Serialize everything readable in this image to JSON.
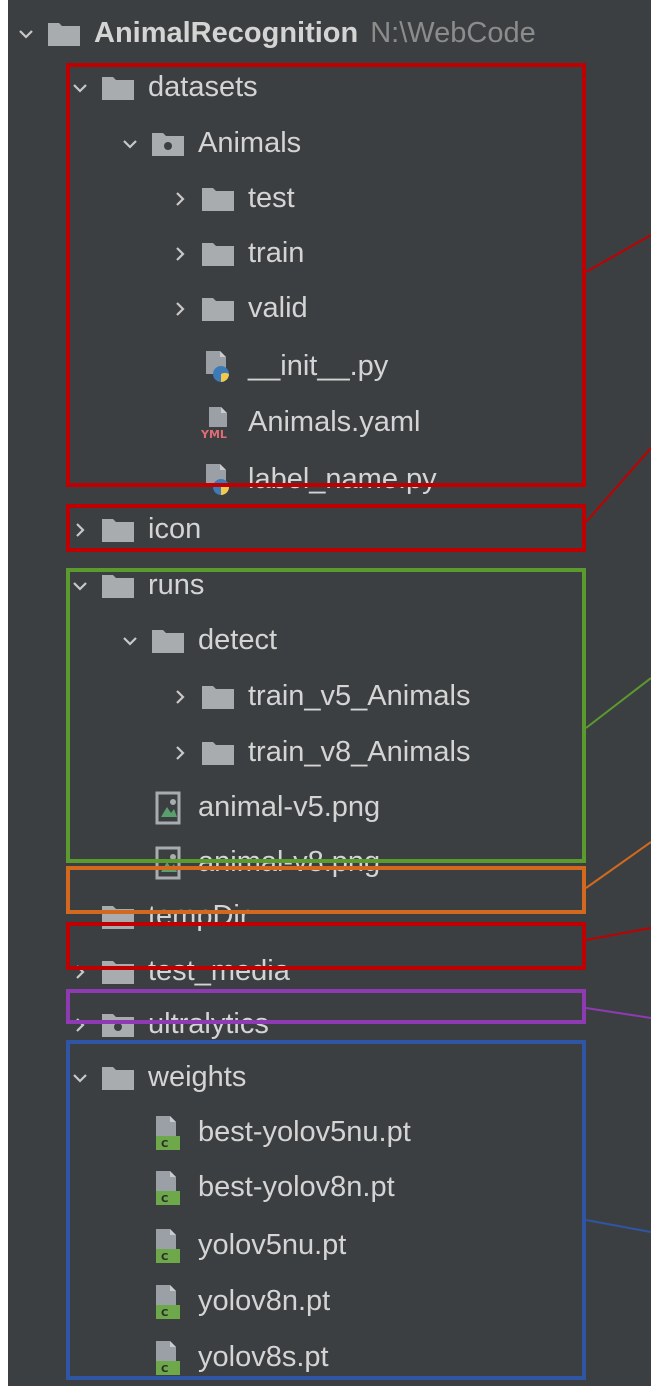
{
  "tree": {
    "root": {
      "label": "AnimalRecognition",
      "path": "N:\\WebCode"
    },
    "items": [
      {
        "label": "datasets",
        "icon": "folder-icon",
        "chevron": "expanded"
      },
      {
        "label": "Animals",
        "icon": "package-folder-icon",
        "chevron": "expanded"
      },
      {
        "label": "test",
        "icon": "folder-icon",
        "chevron": "collapsed"
      },
      {
        "label": "train",
        "icon": "folder-icon",
        "chevron": "collapsed"
      },
      {
        "label": "valid",
        "icon": "folder-icon",
        "chevron": "collapsed"
      },
      {
        "label": "__init__.py",
        "icon": "python-file-icon",
        "chevron": "none"
      },
      {
        "label": "Animals.yaml",
        "icon": "yaml-file-icon",
        "chevron": "none",
        "icon_text": "YML"
      },
      {
        "label": "label_name.py",
        "icon": "python-file-icon",
        "chevron": "none"
      },
      {
        "label": "icon",
        "icon": "folder-icon",
        "chevron": "collapsed"
      },
      {
        "label": "runs",
        "icon": "folder-icon",
        "chevron": "expanded"
      },
      {
        "label": "detect",
        "icon": "folder-icon",
        "chevron": "expanded"
      },
      {
        "label": "train_v5_Animals",
        "icon": "folder-icon",
        "chevron": "collapsed"
      },
      {
        "label": "train_v8_Animals",
        "icon": "folder-icon",
        "chevron": "collapsed"
      },
      {
        "label": "animal-v5.png",
        "icon": "image-file-icon",
        "chevron": "none"
      },
      {
        "label": "animal-v8.png",
        "icon": "image-file-icon",
        "chevron": "none"
      },
      {
        "label": "tempDir",
        "icon": "folder-icon",
        "chevron": "none"
      },
      {
        "label": "test_media",
        "icon": "folder-icon",
        "chevron": "collapsed"
      },
      {
        "label": "ultralytics",
        "icon": "package-folder-icon",
        "chevron": "collapsed"
      },
      {
        "label": "weights",
        "icon": "folder-icon",
        "chevron": "expanded"
      },
      {
        "label": "best-yolov5nu.pt",
        "icon": "pt-file-icon",
        "chevron": "none",
        "icon_text": "C"
      },
      {
        "label": "best-yolov8n.pt",
        "icon": "pt-file-icon",
        "chevron": "none",
        "icon_text": "C"
      },
      {
        "label": "yolov5nu.pt",
        "icon": "pt-file-icon",
        "chevron": "none",
        "icon_text": "C"
      },
      {
        "label": "yolov8n.pt",
        "icon": "pt-file-icon",
        "chevron": "none",
        "icon_text": "C"
      },
      {
        "label": "yolov8s.pt",
        "icon": "pt-file-icon",
        "chevron": "none",
        "icon_text": "C"
      }
    ]
  },
  "colors": {
    "panel_bg": "#3c3f41",
    "text": "#d4d4d4",
    "folder": "#a9acaf",
    "annotation_red": "#c00000",
    "annotation_green": "#5a9a2e",
    "annotation_orange": "#d2691e",
    "annotation_purple": "#8e3ab3",
    "annotation_blue": "#2f55a4"
  }
}
